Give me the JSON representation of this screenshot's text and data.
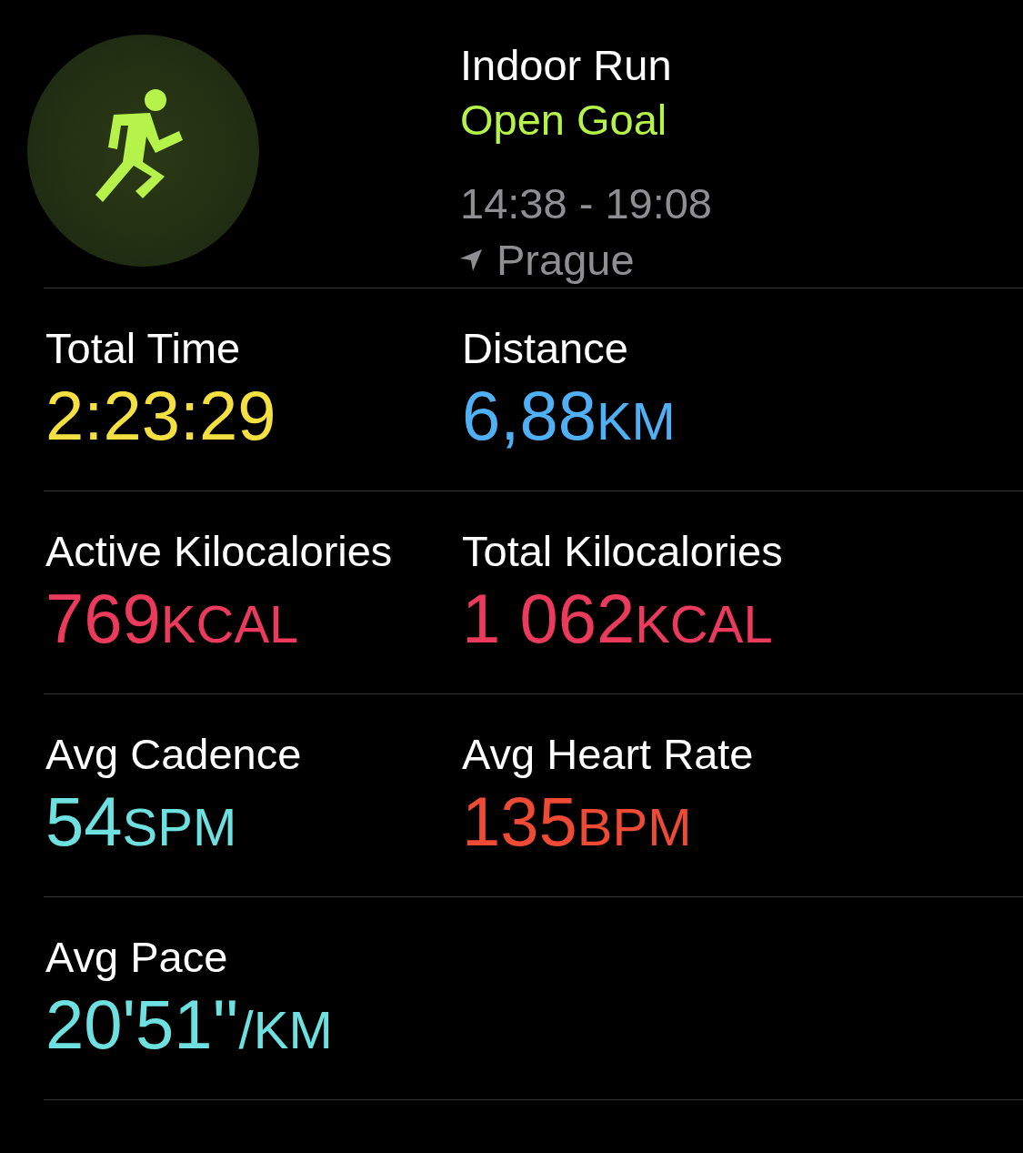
{
  "workout": {
    "title": "Indoor Run",
    "goal": "Open Goal",
    "time_range": "14:38 - 19:08",
    "location": "Prague"
  },
  "metrics": [
    {
      "label": "Total Time",
      "value": "2:23:29",
      "color": "#f5e042"
    },
    {
      "label": "Distance",
      "value": "6,88",
      "unit": "KM",
      "color": "#4fb0f5"
    },
    {
      "label": "Active Kilocalories",
      "value": "769",
      "unit": "KCAL",
      "color": "#ec3a5c"
    },
    {
      "label": "Total Kilocalories",
      "value": "1 062",
      "unit": "KCAL",
      "color": "#ec3a5c"
    },
    {
      "label": "Avg Cadence",
      "value": "54",
      "unit": "SPM",
      "color": "#6ee0e0"
    },
    {
      "label": "Avg Heart Rate",
      "value": "135",
      "unit": "BPM",
      "color": "#ee4a34"
    },
    {
      "label": "Avg Pace",
      "value": "20'51''",
      "unit": "/KM",
      "color": "#6ee0e0"
    }
  ]
}
